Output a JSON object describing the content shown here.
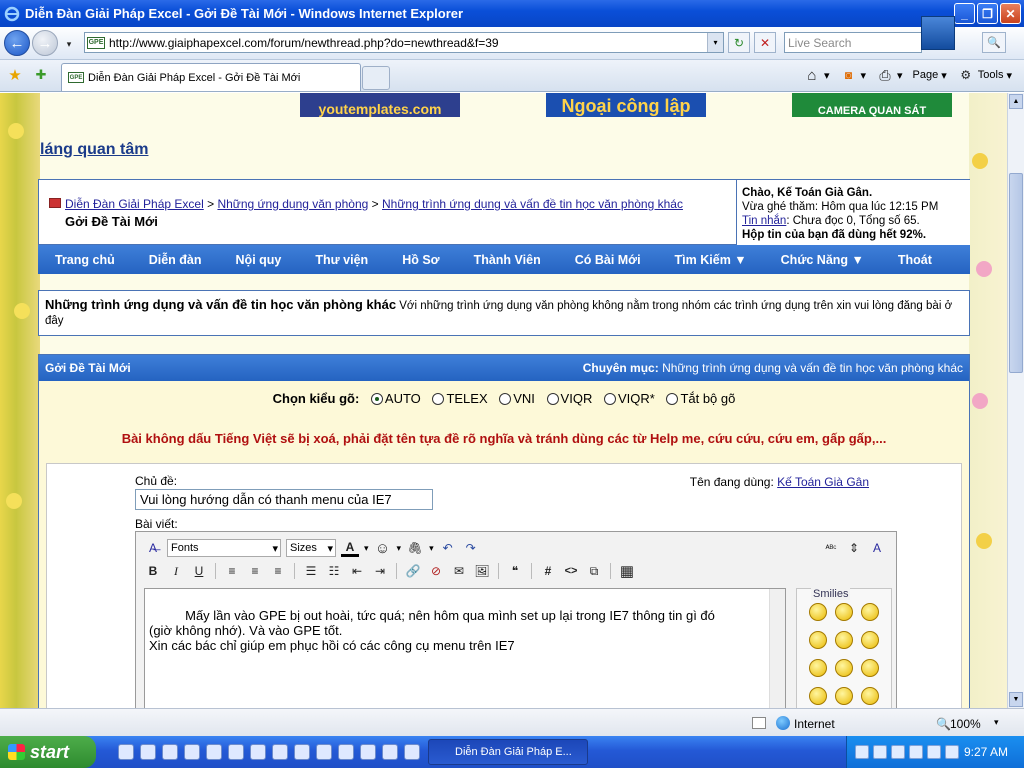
{
  "window": {
    "title": "Diễn Đàn Giải Pháp Excel - Gởi Đề Tài Mới - Windows Internet Explorer",
    "minimize_glyph": "_",
    "maximize_glyph": "❐",
    "close_glyph": "✕"
  },
  "browser": {
    "back_glyph": "←",
    "forward_glyph": "→",
    "url": "http://www.giaiphapexcel.com/forum/newthread.php?do=newthread&f=39",
    "favicon": "GPE",
    "url_dropdown_glyph": "▾",
    "refresh_glyph": "↻",
    "stop_glyph": "✕",
    "search_placeholder": "Live Search",
    "search_glyph": "🔍",
    "tab_title": "Diễn Đàn Giải Pháp Excel - Gởi Đề Tài Mới",
    "star_glyph": "★",
    "add_fav_glyph": "✚",
    "home_glyph": "⌂",
    "feeds_glyph": "◙",
    "print_glyph": "⎙",
    "page_label": "Page",
    "tools_label": "Tools",
    "dropdown_glyph": "▾"
  },
  "banners": {
    "b1": "youtemplates.com",
    "b2": "Ngoại công lập",
    "b3": "CAMERA QUAN SÁT"
  },
  "page": {
    "heading_link": "láng quan tâm",
    "breadcrumb": {
      "home": "Diễn Đàn Giải Pháp Excel",
      "sep": ">",
      "level1": "Những ứng dụng văn phòng",
      "level2": "Những trình ứng dụng và vấn đề tin học văn phòng khác",
      "current": "Gởi Đề Tài Mới"
    },
    "user": {
      "greeting_prefix": "Chào, ",
      "name": "Kế Toán Già Gân",
      "greeting_suffix": ".",
      "last_visit": "Vừa ghé thăm: Hôm qua lúc 12:15 PM",
      "pm_link": "Tin nhắn",
      "pm_status": ": Chưa đọc 0, Tổng số 65.",
      "quota": "Hộp tin của bạn đã dùng hết 92%."
    },
    "menu": {
      "home": "Trang chủ",
      "forum": "Diễn đàn",
      "rules": "Nội quy",
      "library": "Thư viện",
      "profile": "Hồ Sơ",
      "members": "Thành Viên",
      "new_posts": "Có Bài Mới",
      "search": "Tìm Kiếm ▼",
      "functions": "Chức Năng ▼",
      "logout": "Thoát"
    },
    "forum_info": {
      "title": "Những trình ứng dụng và vấn đề tin học văn phòng khác",
      "description": "Với những trình ứng dụng văn phòng không nằm trong nhóm các trình ứng dụng trên xin vui lòng đăng bài ở đây"
    },
    "panel": {
      "title": "Gởi Đề Tài Mới",
      "category_label": "Chuyên mục:",
      "category_value": "Những trình ứng dụng và vấn đề tin học văn phòng khác"
    },
    "typing": {
      "label": "Chọn kiểu gõ:",
      "options": [
        "AUTO",
        "TELEX",
        "VNI",
        "VIQR",
        "VIQR*",
        "Tắt bộ gõ"
      ],
      "selected": "AUTO"
    },
    "warning": "Bài không dấu Tiếng Việt sẽ bị xoá, phải đặt tên tựa đề rõ nghĩa và tránh dùng các từ Help me, cứu cứu, cứu em, gấp gấp,...",
    "form": {
      "subject_label": "Chủ đề:",
      "subject_value": "Vui lòng hướng dẫn có thanh menu của IE7",
      "username_label": "Tên đang dùng:",
      "username_value": "Kế Toán Già Gân",
      "message_label": "Bài viết:",
      "font_select": "Fonts",
      "size_select": "Sizes",
      "message_body": "Mấy lần vào GPE bị out hoài, tức quá; nên hôm qua mình set up lại trong IE7 thông tin gì đó\n(giờ không nhớ). Và vào GPE tốt.\nXin các bác chỉ giúp em phục hồi có các công cụ menu trên IE7",
      "smilies_title": "Smilies"
    },
    "toolbar_glyphs": {
      "remove_format": "A̶",
      "bold": "B",
      "italic": "I",
      "underline": "U",
      "font_color": "A",
      "smiley": "☺",
      "attach": "🖇",
      "undo": "↶",
      "redo": "↷",
      "spell": "ᴬᴮᶜ",
      "resize": "⇕",
      "hash": "#",
      "code": "<>",
      "html": "⧉",
      "table": "▦",
      "align_left": "≡",
      "align_center": "≡",
      "align_right": "≡",
      "ordered_list": "☰",
      "unordered_list": "☷",
      "outdent": "⇤",
      "indent": "⇥",
      "link": "🔗",
      "unlink": "⊘",
      "email": "✉",
      "image": "🖼",
      "quote": "❝"
    }
  },
  "statusbar": {
    "zone": "Internet",
    "zoom": "100%"
  },
  "taskbar": {
    "start": "start",
    "task": "Diễn Đàn Giải Pháp E...",
    "clock": "9:27 AM"
  },
  "colors": {
    "accent": "#2563c1",
    "warning": "#b01010",
    "link": "#22229a"
  }
}
